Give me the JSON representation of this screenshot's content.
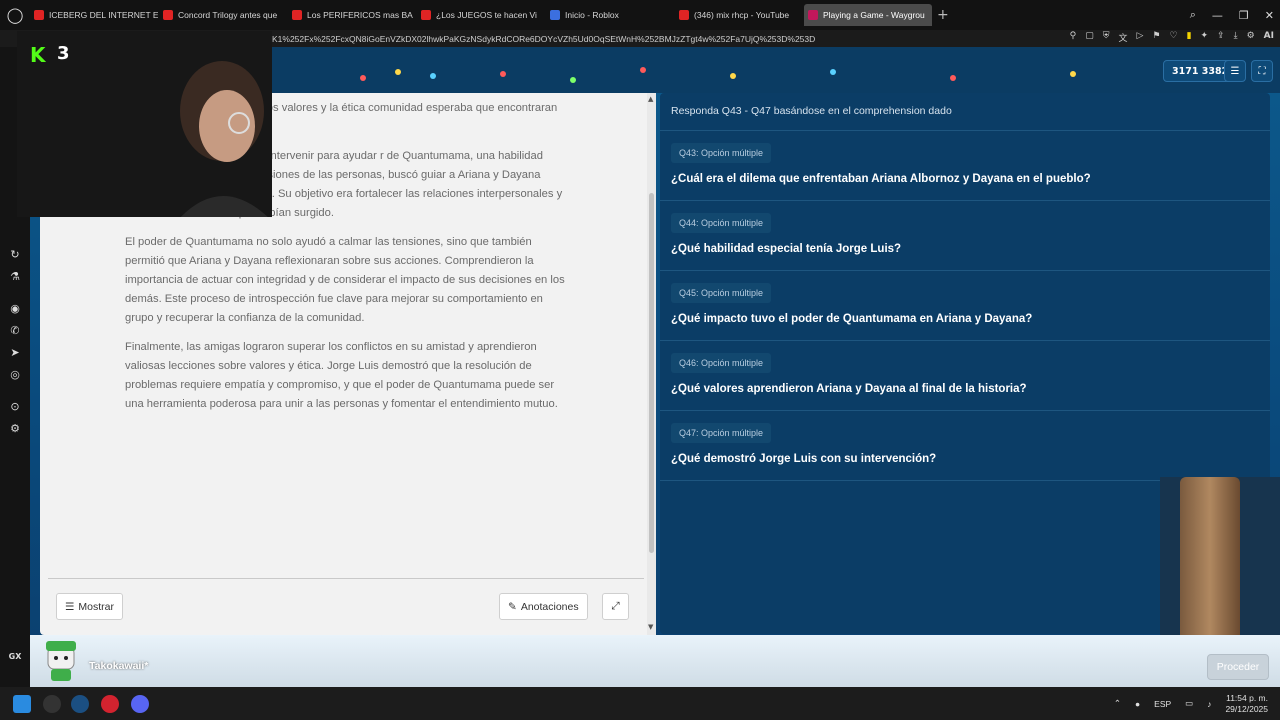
{
  "browser": {
    "tabs": [
      {
        "label": "ICEBERG DEL INTERNET E",
        "favicon_color": "#e02424"
      },
      {
        "label": "Concord Trilogy antes que",
        "favicon_color": "#e02424"
      },
      {
        "label": "Los PERIFERICOS mas BA",
        "favicon_color": "#e02424"
      },
      {
        "label": "¿Los JUEGOS te hacen Vi",
        "favicon_color": "#e02424"
      },
      {
        "label": "Inicio - Roblox",
        "favicon_color": "#3b6fe0"
      },
      {
        "label": "(346) mix rhcp - YouTube",
        "favicon_color": "#e02424"
      },
      {
        "label": "Playing a Game - Waygrou",
        "favicon_color": "#c2185b",
        "active": true
      }
    ],
    "address": "K1%252Fx%252FcxQN8iGoEnVZkDX02lhwkPaKGzNSdykRdCORe6DOYcVZh5Ud0OqSEtWnH%252BMJzZTgt4w%252Fa7UjQ%253D%253D",
    "win_controls": [
      "search-icon",
      "minimize-icon",
      "restore-icon",
      "close-icon"
    ],
    "toolbar_ai_label": "AI"
  },
  "webcam": {
    "platform_icon": "K",
    "viewer_count": "3"
  },
  "header": {
    "score": "3171 3382",
    "menu_icon": "menu-icon",
    "fullscreen_icon": "fullscreen-icon"
  },
  "reading": {
    "paragraphs": [
      "ntes, quienes cuestionaban los valores y la ética comunidad esperaba que encontraran una eto y responsabilidad.",
      "ido por su sabiduría, decidió intervenir para ayudar r de Quantumama, una habilidad especial que le ciones y decisiones de las personas, buscó guiar a Ariana y Dayana hacia un camino más positivo. Su objetivo era fortalecer las relaciones interpersonales y resolver los conflictos que habían surgido.",
      "El poder de Quantumama no solo ayudó a calmar las tensiones, sino que también permitió que Ariana y Dayana reflexionaran sobre sus acciones. Comprendieron la importancia de actuar con integridad y de considerar el impacto de sus decisiones en los demás. Este proceso de introspección fue clave para mejorar su comportamiento en grupo y recuperar la confianza de la comunidad.",
      "Finalmente, las amigas lograron superar los conflictos en su amistad y aprendieron valiosas lecciones sobre valores y ética. Jorge Luis demostró que la resolución de problemas requiere empatía y compromiso, y que el poder de Quantumama puede ser una herramienta poderosa para unir a las personas y fomentar el entendimiento mutuo."
    ],
    "show_button": "Mostrar",
    "annotations_button": "Anotaciones"
  },
  "questions": {
    "instruction": "Responda Q43 - Q47 basándose en el comprehension dado",
    "items": [
      {
        "badge": "Q43: Opción múltiple",
        "text": "¿Cuál era el dilema que enfrentaban Ariana Albornoz y Dayana en el pueblo?"
      },
      {
        "badge": "Q44: Opción múltiple",
        "text": "¿Qué habilidad especial tenía Jorge Luis?"
      },
      {
        "badge": "Q45: Opción múltiple",
        "text": "¿Qué impacto tuvo el poder de Quantumama en Ariana y Dayana?"
      },
      {
        "badge": "Q46: Opción múltiple",
        "text": "¿Qué valores aprendieron Ariana y Dayana al final de la historia?"
      },
      {
        "badge": "Q47: Opción múltiple",
        "text": "¿Qué demostró Jorge Luis con su intervención?"
      }
    ]
  },
  "footer": {
    "player_name": "Takokawaii*",
    "proceed_button": "Proceder"
  },
  "sidebar": {
    "label": "GX"
  },
  "taskbar": {
    "language": "ESP",
    "time": "11:54 p. m.",
    "date": "29/12/2025"
  }
}
